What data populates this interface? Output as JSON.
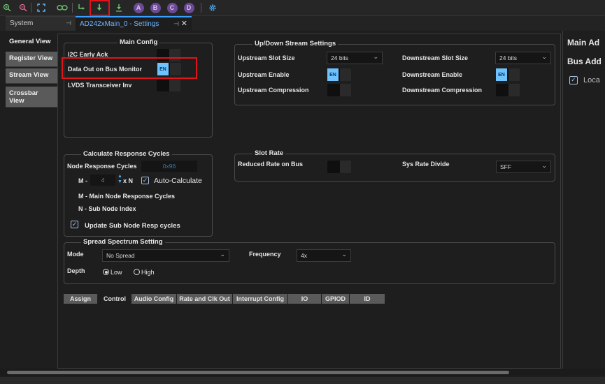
{
  "toolbar": {
    "icons": [
      "zoom-in-icon",
      "zoom-out-icon",
      "fit-screen-icon",
      "link-icon",
      "route-icon",
      "download-icon",
      "download-alt-icon",
      "node-a-icon",
      "node-b-icon",
      "node-c-icon",
      "node-d-icon",
      "settings-gear-icon"
    ],
    "circle_labels": {
      "a": "A",
      "b": "B",
      "c": "C",
      "d": "D"
    }
  },
  "tabs": {
    "system": "System",
    "settings": "AD242xMain_0 - Settings"
  },
  "sidenav": {
    "items": [
      "General View",
      "Register View",
      "Stream View",
      "Crossbar View"
    ]
  },
  "main_config": {
    "title": "Main Config",
    "i2c_early_ack": "I2C Early Ack",
    "data_out": "Data Out on Bus Monitor",
    "data_out_toggle": "EN",
    "lvds": "LVDS Transceiver Inv"
  },
  "updown": {
    "title": "Up/Down Stream Settings",
    "upstream_slot_size": "Upstream Slot Size",
    "upstream_slot_value": "24 bits",
    "downstream_slot_size": "Downstream Slot Size",
    "downstream_slot_value": "24 bits",
    "upstream_enable": "Upstream Enable",
    "upstream_enable_toggle": "EN",
    "downstream_enable": "Downstream Enable",
    "downstream_enable_toggle": "EN",
    "upstream_compression": "Upstream Compression",
    "downstream_compression": "Downstream Compression"
  },
  "response": {
    "title": "Calculate Response Cycles",
    "node_response": "Node Response Cycles",
    "node_response_value": "0x96",
    "m_label": "M -",
    "m_value": "4",
    "x_n": "x N",
    "auto_calc": "Auto-Calculate",
    "m_desc": "M - Main Node Response Cycles",
    "n_desc": "N - Sub Node Index",
    "update_sub": "Update Sub Node Resp cycles"
  },
  "slot_rate": {
    "title": "Slot Rate",
    "reduced_rate": "Reduced Rate on Bus",
    "sys_rate_divide": "Sys Rate Divide",
    "sys_rate_value": "SFF"
  },
  "spread": {
    "title": "Spread Spectrum Setting",
    "mode": "Mode",
    "mode_value": "No Spread",
    "frequency": "Frequency",
    "frequency_value": "4x",
    "depth": "Depth",
    "low": "Low",
    "high": "High"
  },
  "bottom_tabs": [
    "Assign",
    "Control",
    "Audio Config",
    "Rate and Clk Out",
    "Interrupt Config",
    "IO",
    "GPIOD",
    "ID"
  ],
  "right_panel": {
    "main_addr": "Main Ad",
    "bus_addr": "Bus Add",
    "local": "Loca"
  },
  "colors": {
    "accent": "#3aa0ff",
    "toggle_on": "#6ec3ff",
    "highlight": "#e0141b",
    "tab_unselected": "#5a5a5a"
  }
}
